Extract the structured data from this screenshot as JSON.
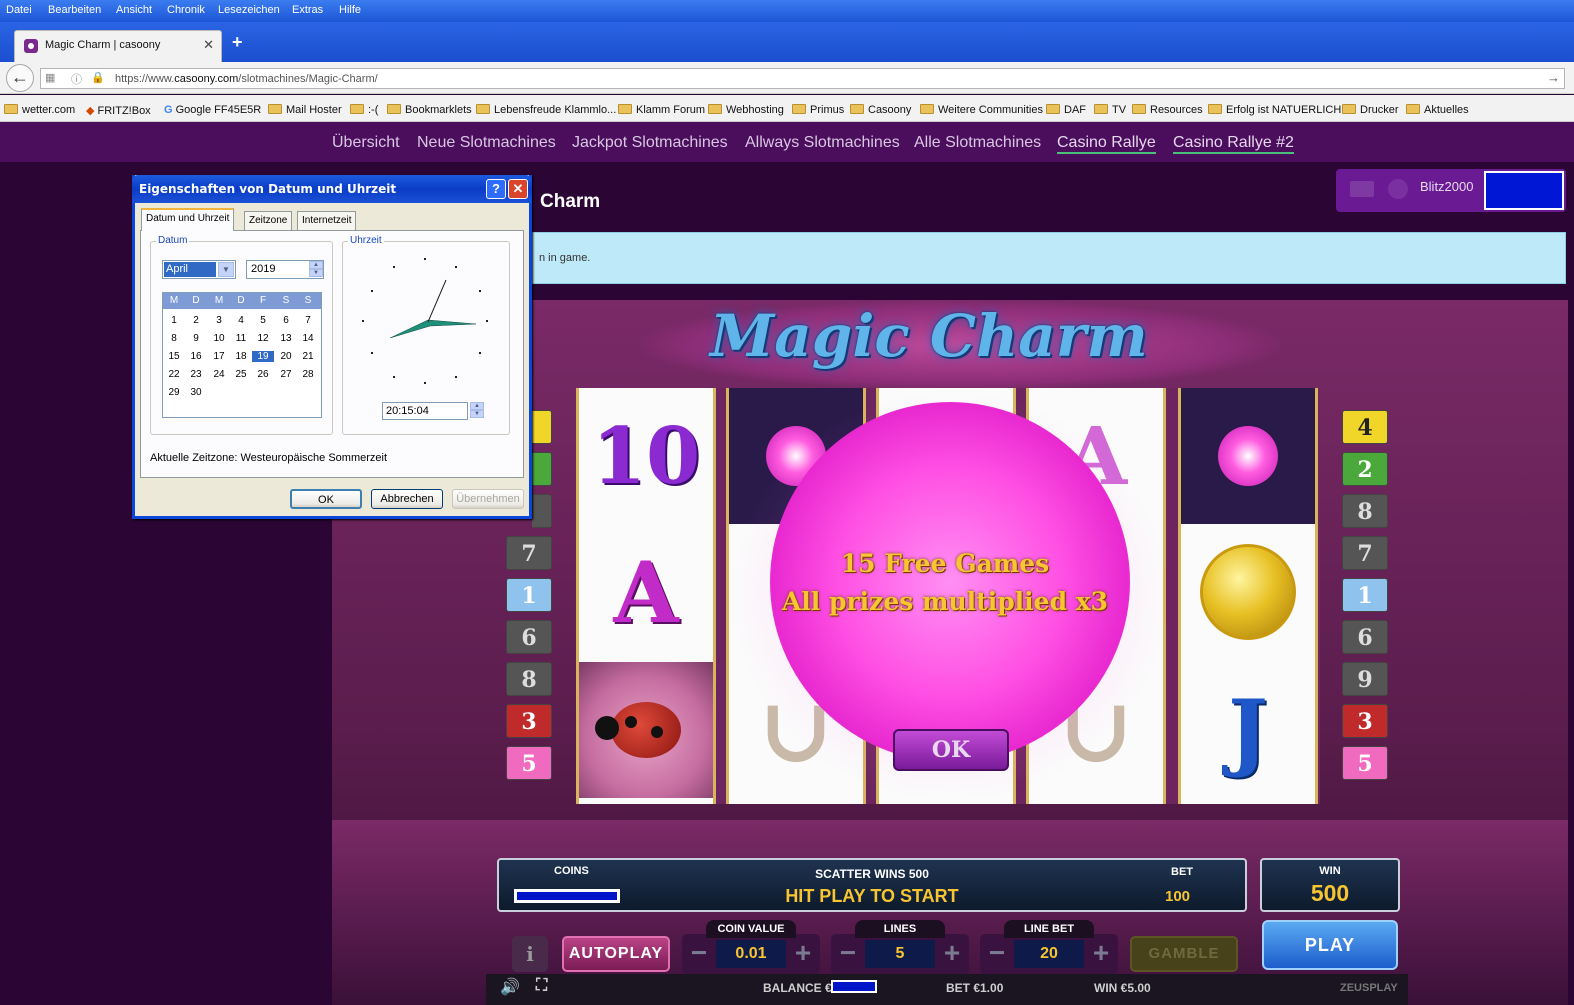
{
  "browser": {
    "menu": [
      "Datei",
      "Bearbeiten",
      "Ansicht",
      "Chronik",
      "Lesezeichen",
      "Extras",
      "Hilfe"
    ],
    "tab_title": "Magic Charm | casoony",
    "url_prefix": "https://www.",
    "url_domain": "casoony.com",
    "url_path": "/slotmachines/Magic-Charm/",
    "bookmarks": [
      "wetter.com",
      "FRITZ!Box",
      "Google FF45E5R",
      "Mail Hoster",
      ":-(",
      "Bookmarklets",
      "Lebensfreude Klammlo...",
      "Klamm Forum",
      "Webhosting",
      "Primus",
      "Casoony",
      "Weitere Communities",
      "DAF",
      "TV",
      "Resources",
      "Erfolg ist NATUERLICH",
      "Drucker",
      "Aktuelles"
    ]
  },
  "site": {
    "nav": [
      "Übersicht",
      "Neue Slotmachines",
      "Jackpot Slotmachines",
      "Allways Slotmachines",
      "Alle Slotmachines",
      "Casino Rallye",
      "Casino Rallye #2"
    ],
    "username": "Blitz2000",
    "game_title": "Charm",
    "info_text": "n in game."
  },
  "slot": {
    "logo": "Magic Charm",
    "left_lines": [
      "",
      "",
      "",
      "7",
      "1",
      "6",
      "8",
      "3",
      "5"
    ],
    "right_lines": [
      "4",
      "2",
      "8",
      "7",
      "1",
      "6",
      "9",
      "3",
      "5"
    ],
    "reel1": [
      "10",
      "A",
      ""
    ],
    "reel3": [
      "A"
    ],
    "reel5": [
      "",
      "",
      "J"
    ],
    "popup_line1": "15 Free Games",
    "popup_line2": "All prizes multiplied x3",
    "ok": "OK",
    "coins_label": "COINS",
    "scatter": "SCATTER WINS 500",
    "hit_play": "HIT PLAY TO START",
    "bet_label": "BET",
    "bet_value": "100",
    "win_label": "WIN",
    "win_value": "500",
    "info": "i",
    "autoplay": "AUTOPLAY",
    "coin_value_label": "COIN VALUE",
    "coin_value": "0.01",
    "lines_label": "LINES",
    "lines": "5",
    "line_bet_label": "LINE BET",
    "line_bet": "20",
    "gamble": "GAMBLE",
    "play": "PLAY",
    "balance_label": "BALANCE €",
    "bet_status": "BET €1.00",
    "win_status": "WIN €5.00",
    "provider": "ZEUSPLAY"
  },
  "dialog": {
    "title": "Eigenschaften von Datum und Uhrzeit",
    "tabs": [
      "Datum und Uhrzeit",
      "Zeitzone",
      "Internetzeit"
    ],
    "date_group": "Datum",
    "time_group": "Uhrzeit",
    "month": "April",
    "year": "2019",
    "weekdays": [
      "M",
      "D",
      "M",
      "D",
      "F",
      "S",
      "S"
    ],
    "days": [
      [
        "1",
        "2",
        "3",
        "4",
        "5",
        "6",
        "7"
      ],
      [
        "8",
        "9",
        "10",
        "11",
        "12",
        "13",
        "14"
      ],
      [
        "15",
        "16",
        "17",
        "18",
        "19",
        "20",
        "21"
      ],
      [
        "22",
        "23",
        "24",
        "25",
        "26",
        "27",
        "28"
      ],
      [
        "29",
        "30",
        "",
        "",
        "",
        "",
        ""
      ]
    ],
    "selected_day": "19",
    "time": "20:15:04",
    "timezone": "Aktuelle Zeitzone: Westeuropäische Sommerzeit",
    "ok": "OK",
    "cancel": "Abbrechen",
    "apply": "Übernehmen"
  }
}
